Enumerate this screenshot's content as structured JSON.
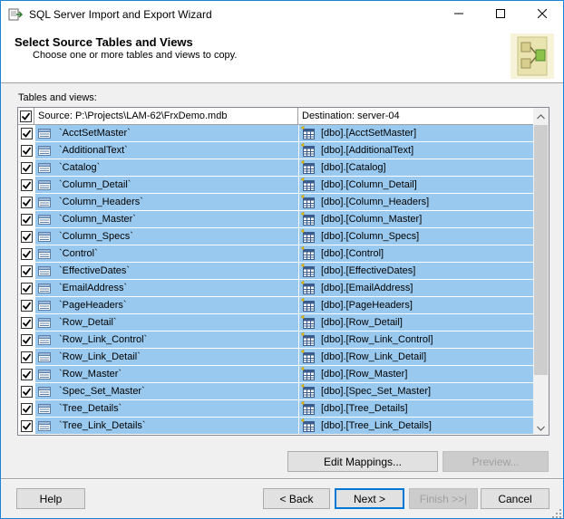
{
  "window": {
    "title": "SQL Server Import and Export Wizard"
  },
  "header": {
    "title": "Select Source Tables and Views",
    "subtitle": "Choose one or more tables and views to copy."
  },
  "grid": {
    "label": "Tables and views:",
    "source_header": "Source: P:\\Projects\\LAM-62\\FrxDemo.mdb",
    "destination_header": "Destination: server-04",
    "rows": [
      {
        "source": "`AcctSetMaster`",
        "destination": "[dbo].[AcctSetMaster]",
        "checked": true
      },
      {
        "source": "`AdditionalText`",
        "destination": "[dbo].[AdditionalText]",
        "checked": true
      },
      {
        "source": "`Catalog`",
        "destination": "[dbo].[Catalog]",
        "checked": true
      },
      {
        "source": "`Column_Detail`",
        "destination": "[dbo].[Column_Detail]",
        "checked": true
      },
      {
        "source": "`Column_Headers`",
        "destination": "[dbo].[Column_Headers]",
        "checked": true
      },
      {
        "source": "`Column_Master`",
        "destination": "[dbo].[Column_Master]",
        "checked": true
      },
      {
        "source": "`Column_Specs`",
        "destination": "[dbo].[Column_Specs]",
        "checked": true
      },
      {
        "source": "`Control`",
        "destination": "[dbo].[Control]",
        "checked": true
      },
      {
        "source": "`EffectiveDates`",
        "destination": "[dbo].[EffectiveDates]",
        "checked": true
      },
      {
        "source": "`EmailAddress`",
        "destination": "[dbo].[EmailAddress]",
        "checked": true
      },
      {
        "source": "`PageHeaders`",
        "destination": "[dbo].[PageHeaders]",
        "checked": true
      },
      {
        "source": "`Row_Detail`",
        "destination": "[dbo].[Row_Detail]",
        "checked": true
      },
      {
        "source": "`Row_Link_Control`",
        "destination": "[dbo].[Row_Link_Control]",
        "checked": true
      },
      {
        "source": "`Row_Link_Detail`",
        "destination": "[dbo].[Row_Link_Detail]",
        "checked": true
      },
      {
        "source": "`Row_Master`",
        "destination": "[dbo].[Row_Master]",
        "checked": true
      },
      {
        "source": "`Spec_Set_Master`",
        "destination": "[dbo].[Spec_Set_Master]",
        "checked": true
      },
      {
        "source": "`Tree_Details`",
        "destination": "[dbo].[Tree_Details]",
        "checked": true
      },
      {
        "source": "`Tree_Link_Details`",
        "destination": "[dbo].[Tree_Link_Details]",
        "checked": true
      }
    ]
  },
  "buttons": {
    "edit_mappings": "Edit Mappings...",
    "preview": "Preview...",
    "help": "Help",
    "back": "< Back",
    "next": "Next >",
    "finish": "Finish >>|",
    "cancel": "Cancel"
  },
  "colors": {
    "selection": "#99c9ef",
    "window_border": "#1883d7",
    "default_button_border": "#0078d7"
  }
}
